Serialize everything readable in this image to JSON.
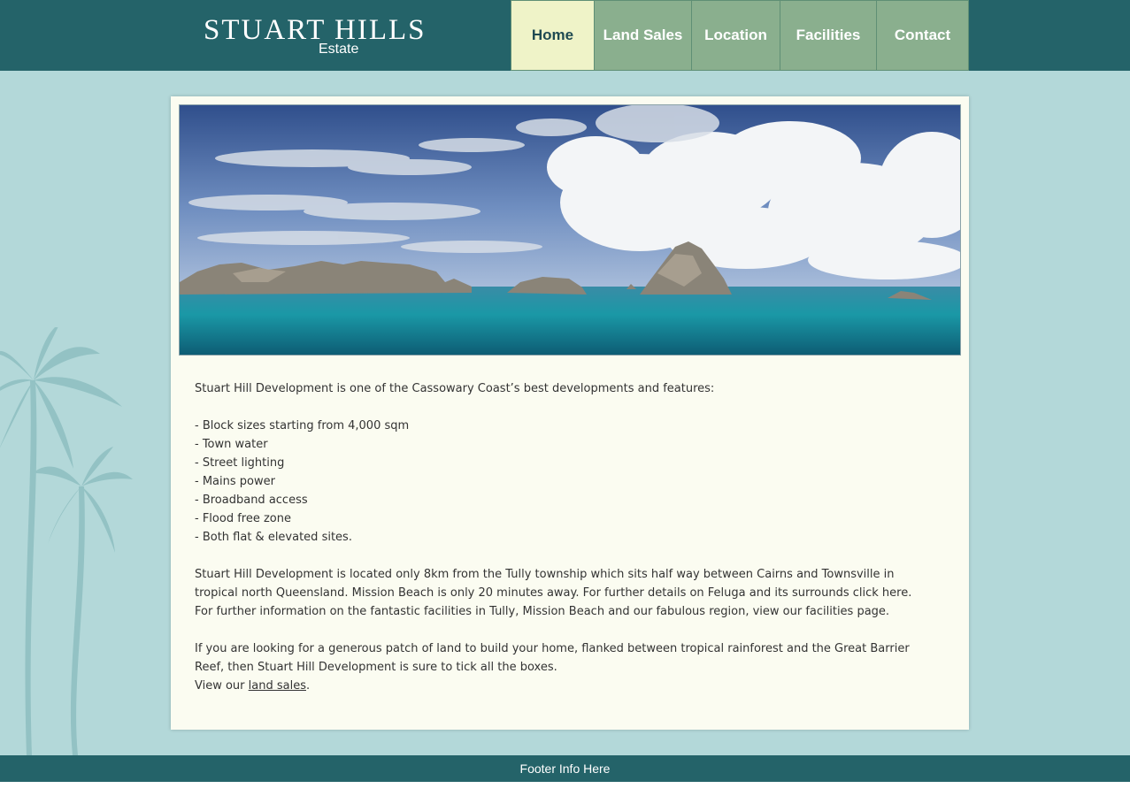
{
  "brand": {
    "name": "STUART HILLS",
    "tagline": "Estate"
  },
  "nav": [
    {
      "label": "Home",
      "active": true
    },
    {
      "label": "Land Sales",
      "active": false
    },
    {
      "label": "Location",
      "active": false
    },
    {
      "label": "Facilities",
      "active": false
    },
    {
      "label": "Contact",
      "active": false
    }
  ],
  "main": {
    "intro": "Stuart Hill Development  is one of the Cassowary Coast’s best developments and features:",
    "features": [
      "- Block sizes starting from 4,000 sqm",
      "- Town water",
      "- Street lighting",
      "- Mains power",
      "- Broadband access",
      "- Flood free zone",
      "- Both flat & elevated sites."
    ],
    "location_lines": [
      "Stuart Hill Development is located only 8km from the Tully township which sits half way between Cairns and Townsville in",
      "tropical north Queensland.  Mission Beach is only 20 minutes away. For further details on Feluga and its surrounds click here.",
      "For further information on the fantastic facilities in Tully, Mission Beach and our fabulous region, view our facilities page."
    ],
    "closing_lines": [
      "If you are looking for a generous patch of land to build your home, flanked between tropical rainforest and the Great Barrier",
      "Reef, then Stuart Hill Development is sure to tick all the boxes."
    ],
    "view_prefix": "View our ",
    "view_link": "land sales",
    "view_suffix": "."
  },
  "footer": {
    "text": "Footer Info Here"
  },
  "colors": {
    "header_bg": "#246369",
    "page_bg": "#b3d8d9",
    "nav_bg": "#8aaf8e",
    "nav_active_bg": "#eff3c8",
    "card_bg": "#fbfcf1"
  }
}
